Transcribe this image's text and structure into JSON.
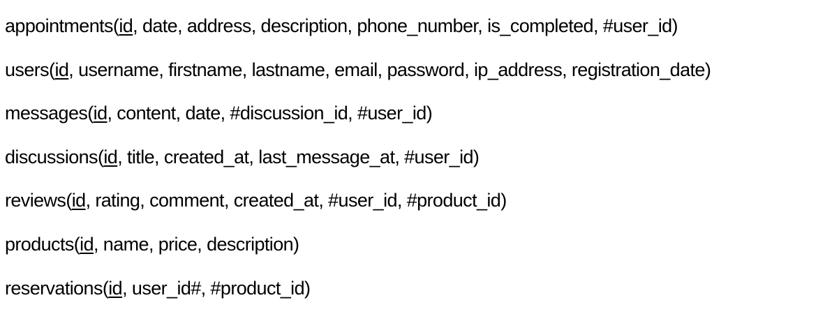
{
  "relations": [
    {
      "table": "appointments",
      "primary_key": "id",
      "rest": ", date, address, description, phone_number, is_completed, #user_id)"
    },
    {
      "table": "users",
      "primary_key": "id",
      "rest": ", username, firstname, lastname, email, password, ip_address, registration_date)"
    },
    {
      "table": "messages",
      "primary_key": "id",
      "rest": ", content, date, #discussion_id, #user_id)"
    },
    {
      "table": "discussions",
      "primary_key": "id",
      "rest": ", title, created_at, last_message_at, #user_id)"
    },
    {
      "table": "reviews",
      "primary_key": "id",
      "rest": ", rating, comment, created_at, #user_id, #product_id)"
    },
    {
      "table": "products",
      "primary_key": "id",
      "rest": ", name, price, description)"
    },
    {
      "table": "reservations",
      "primary_key": "id",
      "rest": ", user_id#, #product_id)"
    }
  ]
}
